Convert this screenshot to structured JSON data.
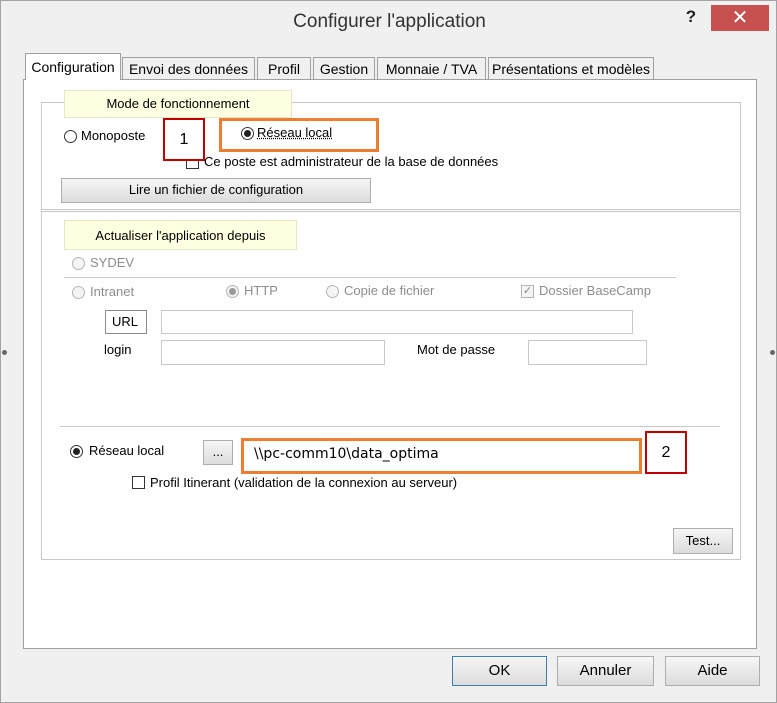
{
  "window": {
    "title": "Configurer l'application",
    "help_label": "?",
    "close_label": "✕"
  },
  "tabs": [
    {
      "label": "Configuration",
      "active": true
    },
    {
      "label": "Envoi des données"
    },
    {
      "label": "Profil"
    },
    {
      "label": "Gestion"
    },
    {
      "label": "Monnaie / TVA"
    },
    {
      "label": "Présentations et modèles"
    }
  ],
  "mode_group": {
    "legend": "Mode de fonctionnement",
    "monoposte_label": "Monoposte",
    "reseau_local_label": "Réseau local",
    "admin_checkbox_label": "Ce poste est administrateur de la base de données",
    "read_config_button": "Lire un fichier de configuration"
  },
  "update_group": {
    "legend": "Actualiser l'application depuis",
    "sydev_label": "SYDEV",
    "intranet_label": "Intranet",
    "http_label": "HTTP",
    "copie_label": "Copie de fichier",
    "basecamp_label": "Dossier BaseCamp",
    "url_label": "URL",
    "url_value": "",
    "login_label": "login",
    "login_value": "",
    "password_label": "Mot de passe",
    "password_value": "",
    "reseau_local_label": "Réseau local",
    "browse_button": "...",
    "path_value": "\\\\pc-comm10\\data_optima",
    "profil_itinerant_label": "Profil Itinerant (validation de la connexion au serveur)",
    "test_button": "Test..."
  },
  "annotations": {
    "marker1": "1",
    "marker2": "2",
    "highlight_color": "#ed7d31",
    "marker_color": "#c00000"
  },
  "footer": {
    "ok_button": "OK",
    "cancel_button": "Annuler",
    "help_button": "Aide"
  }
}
